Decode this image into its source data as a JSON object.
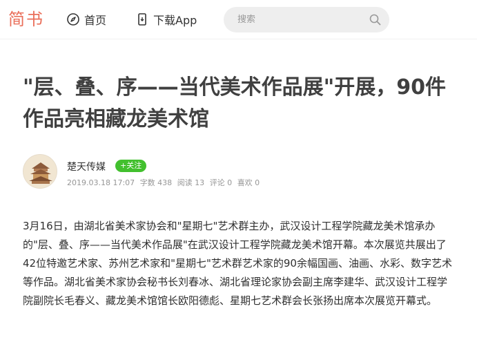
{
  "header": {
    "logo": "简书",
    "nav": [
      {
        "label": "首页",
        "icon": "compass-icon"
      },
      {
        "label": "下载App",
        "icon": "phone-icon"
      }
    ],
    "search_placeholder": "搜索"
  },
  "article": {
    "title": "\"层、叠、序——当代美术作品展\"开展，90件作品亮相藏龙美术馆",
    "author": {
      "name": "楚天传媒",
      "follow_label": "关注"
    },
    "meta": {
      "datetime": "2019.03.18 17:07",
      "word_count": "字数 438",
      "reads": "阅读 13",
      "comments": "评论 0",
      "likes": "喜欢 0"
    },
    "body": "3月16日，由湖北省美术家协会和\"星期七\"艺术群主办，武汉设计工程学院藏龙美术馆承办的\"层、叠、序——当代美术作品展\"在武汉设计工程学院藏龙美术馆开幕。本次展览共展出了42位特邀艺术家、苏州艺术家和\"星期七\"艺术群艺术家的90余幅国画、油画、水彩、数字艺术等作品。湖北省美术家协会秘书长刘春冰、湖北省理论家协会副主席李建华、武汉设计工程学院副院长毛春义、藏龙美术馆馆长欧阳德彪、星期七艺术群会长张扬出席本次展览开幕式。"
  },
  "colors": {
    "brand": "#ea6f5a",
    "follow": "#42c02e"
  }
}
